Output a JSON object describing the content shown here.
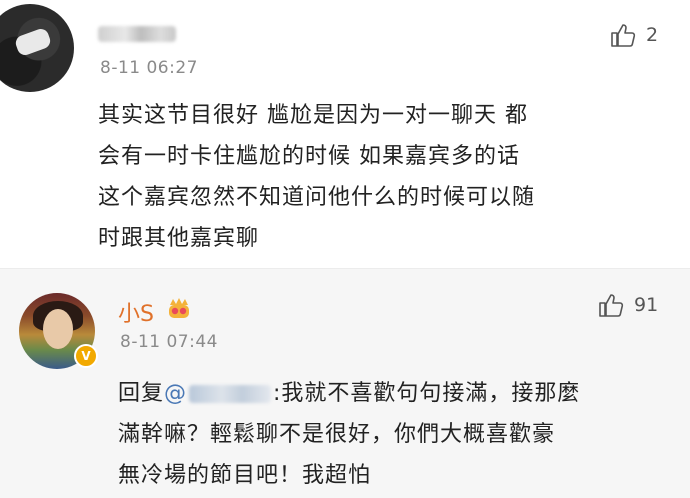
{
  "top_comment": {
    "time": "8-11 06:27",
    "like_count": "2",
    "lines": [
      "其实这节目很好  尴尬是因为一对一聊天  都",
      "会有一时卡住尴尬的时候  如果嘉宾多的话",
      "这个嘉宾忽然不知道问他什么的时候可以随",
      "时跟其他嘉宾聊"
    ]
  },
  "reply": {
    "author": "小S",
    "time": "8-11 07:44",
    "like_count": "91",
    "reply_prefix": "回复",
    "mention_at": "@",
    "line1_rest": ":我就不喜歡句句接滿，接那麼",
    "lines": [
      "滿幹嘛？輕鬆聊不是很好，你們大概喜歡豪",
      "無冷場的節目吧！我超怕"
    ]
  },
  "icons": {
    "like": "thumbs-up-icon",
    "verified": "verified-badge-icon",
    "crown": "crown-icon"
  },
  "colors": {
    "author_name": "#e0712a",
    "mention": "#4a78b5",
    "timestamp": "#8a8a8a",
    "reply_background": "#f6f6f6"
  }
}
